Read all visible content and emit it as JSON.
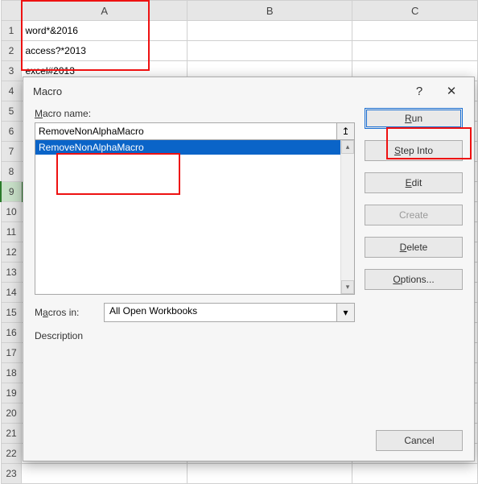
{
  "grid": {
    "col_headers": [
      "A",
      "B",
      "C"
    ],
    "rows": [
      {
        "n": "1",
        "A": "word*&2016"
      },
      {
        "n": "2",
        "A": "access?*2013"
      },
      {
        "n": "3",
        "A": "excel#2013"
      },
      {
        "n": "4"
      },
      {
        "n": "5"
      },
      {
        "n": "6"
      },
      {
        "n": "7"
      },
      {
        "n": "8"
      },
      {
        "n": "9"
      },
      {
        "n": "10"
      },
      {
        "n": "11"
      },
      {
        "n": "12"
      },
      {
        "n": "13"
      },
      {
        "n": "14"
      },
      {
        "n": "15"
      },
      {
        "n": "16"
      },
      {
        "n": "17"
      },
      {
        "n": "18"
      },
      {
        "n": "19"
      },
      {
        "n": "20"
      },
      {
        "n": "21"
      },
      {
        "n": "22"
      },
      {
        "n": "23"
      }
    ],
    "selected_row": 9
  },
  "dialog": {
    "title": "Macro",
    "help": "?",
    "close": "✕",
    "macro_name_label": "Macro name:",
    "macro_name_value": "RemoveNonAlphaMacro",
    "name_button_glyph": "↥",
    "list_items": [
      "RemoveNonAlphaMacro"
    ],
    "selected_index": 0,
    "buttons": {
      "run": "Run",
      "step_into": "Step Into",
      "edit": "Edit",
      "create": "Create",
      "delete": "Delete",
      "options": "Options...",
      "cancel": "Cancel"
    },
    "macros_in_label": "Macros in:",
    "macros_in_value": "All Open Workbooks",
    "description_label": "Description"
  }
}
